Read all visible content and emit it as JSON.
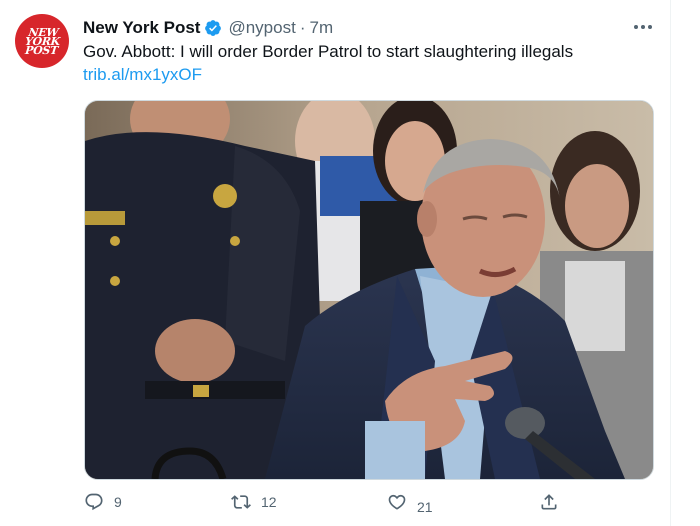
{
  "account": {
    "name": "New York Post",
    "handle": "@nypost",
    "separator": "·",
    "time": "7m",
    "avatar_logo": [
      "NEW",
      "YORK",
      "POST"
    ]
  },
  "tweet": {
    "text": "Gov. Abbott: I will order Border Patrol to start slaughtering illegals",
    "link": "trib.al/mx1yxOF"
  },
  "actions": {
    "reply_count": "9",
    "retweet_count": "12",
    "like_count": "21"
  },
  "colors": {
    "verified": "#1d9bf0",
    "link": "#1d9bf0",
    "muted": "#536471",
    "avatar_bg": "#d7262b"
  },
  "icons": {
    "verified": "verified-badge-icon",
    "more": "more-options-icon",
    "reply": "reply-icon",
    "retweet": "retweet-icon",
    "like": "heart-icon",
    "share": "share-icon"
  }
}
